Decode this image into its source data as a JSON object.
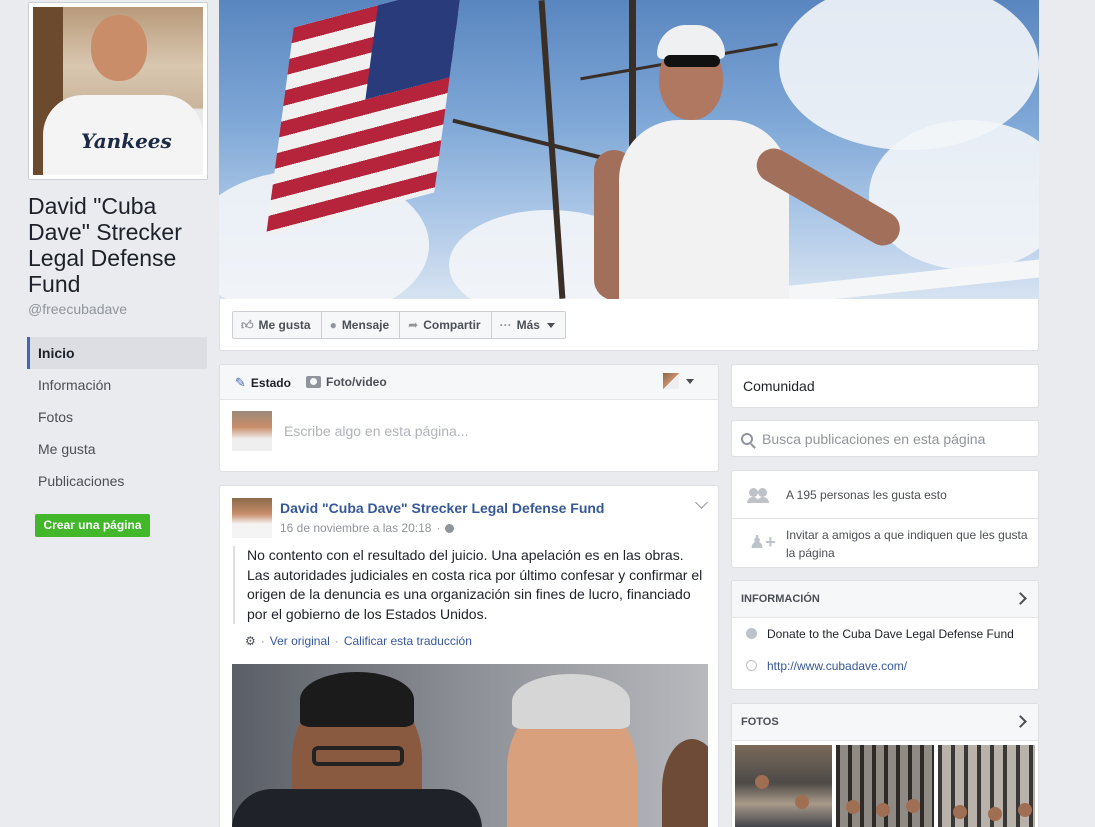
{
  "page": {
    "name": "David \"Cuba Dave\" Strecker Legal Defense Fund",
    "handle": "@freecubadave",
    "profile_shirt_text": "Yankees"
  },
  "left_nav": {
    "items": [
      {
        "label": "Inicio",
        "active": true
      },
      {
        "label": "Información"
      },
      {
        "label": "Fotos"
      },
      {
        "label": "Me gusta"
      },
      {
        "label": "Publicaciones"
      }
    ],
    "create_page_label": "Crear una página"
  },
  "actions": {
    "like": "Me gusta",
    "message": "Mensaje",
    "share": "Compartir",
    "more": "Más"
  },
  "composer": {
    "tab_status": "Estado",
    "tab_photo": "Foto/video",
    "placeholder": "Escribe algo en esta página..."
  },
  "post": {
    "author": "David \"Cuba Dave\" Strecker Legal Defense Fund",
    "timestamp": "16 de noviembre a las 20:18",
    "text": "No contento con el resultado del juicio. Una apelación es en las obras. Las autoridades judiciales en costa rica por último confesar y confirmar el origen de la denuncia es una organización sin fines de lucro, financiado por el gobierno de los Estados Unidos.",
    "see_original": "Ver original",
    "rate_translation": "Calificar esta traducción"
  },
  "sidebar": {
    "community": "Comunidad",
    "search_placeholder": "Busca publicaciones en esta página",
    "likes_text": "A 195 personas les gusta esto",
    "invite_text": "Invitar a amigos a que indiquen que les gusta la página",
    "info_header": "INFORMACIÓN",
    "info_items": [
      "Donate to the Cuba Dave Legal Defense Fund",
      "http://www.cubadave.com/"
    ],
    "photos_header": "FOTOS"
  },
  "colors": {
    "brand_blue": "#4267b2",
    "link_blue": "#365899",
    "create_green": "#42b72a",
    "background": "#e9ebee"
  },
  "icons": [
    "thumbs-up-icon",
    "messenger-icon",
    "share-icon",
    "more-icon",
    "pencil-icon",
    "camera-icon",
    "globe-icon",
    "gear-icon",
    "search-icon",
    "people-icon",
    "invite-icon",
    "chevron-right-icon"
  ]
}
